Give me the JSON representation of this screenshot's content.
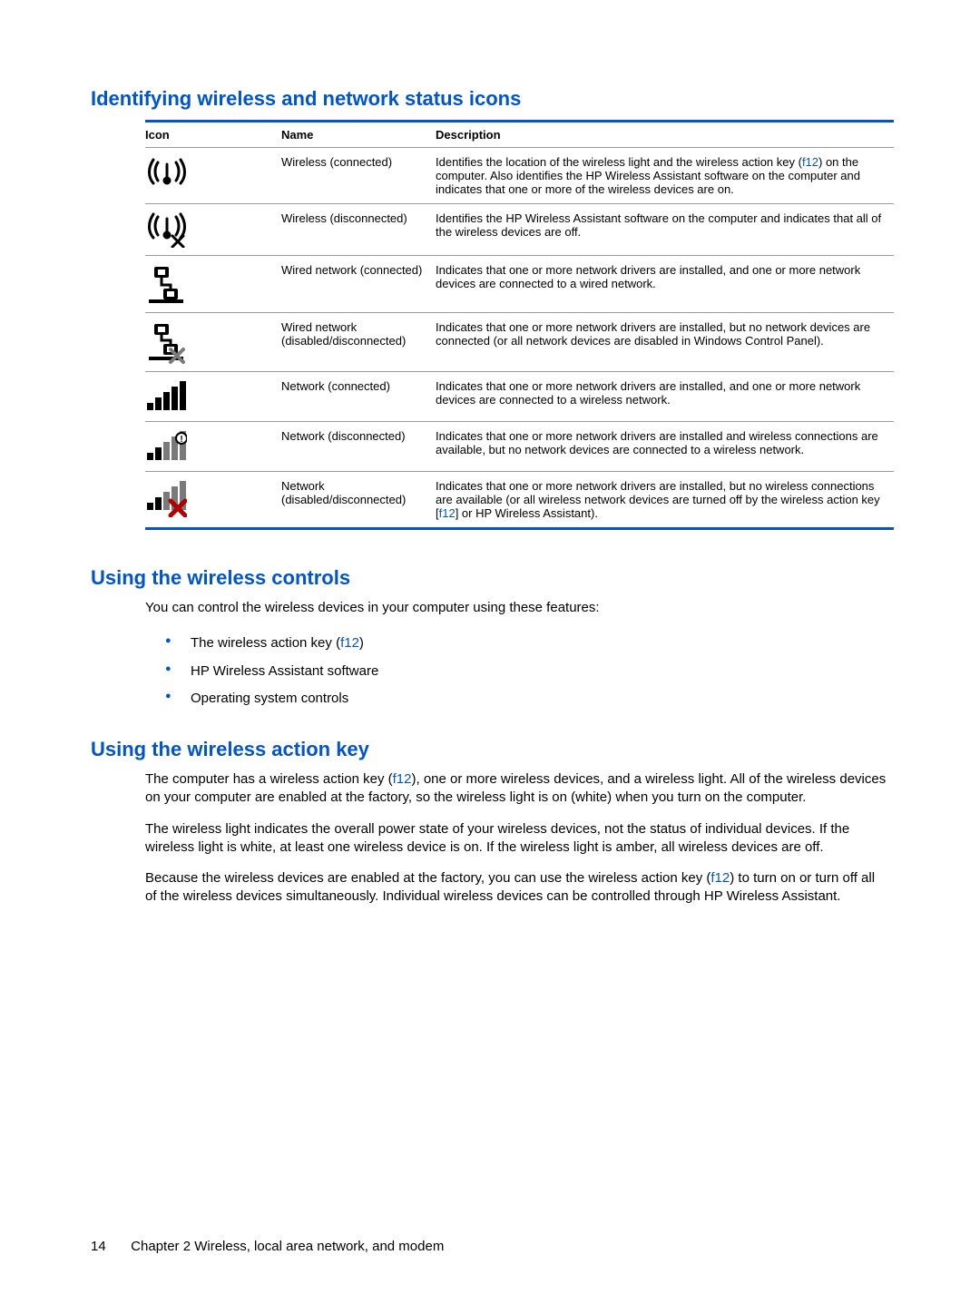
{
  "section1": {
    "title": "Identifying wireless and network status icons",
    "headers": {
      "icon": "Icon",
      "name": "Name",
      "desc": "Description"
    },
    "rows": [
      {
        "name": "Wireless (connected)",
        "desc_pre": "Identifies the location of the wireless light and the wireless action key (",
        "desc_key": "f12",
        "desc_post": ") on the computer. Also identifies the HP Wireless Assistant software on the computer and indicates that one or more of the wireless devices are on."
      },
      {
        "name": "Wireless (disconnected)",
        "desc": "Identifies the HP Wireless Assistant software on the computer and indicates that all of the wireless devices are off."
      },
      {
        "name": "Wired network (connected)",
        "desc": "Indicates that one or more network drivers are installed, and one or more network devices are connected to a wired network."
      },
      {
        "name": "Wired network (disabled/disconnected)",
        "desc": "Indicates that one or more network drivers are installed, but no network devices are connected (or all network devices are disabled in Windows Control Panel)."
      },
      {
        "name": "Network (connected)",
        "desc": "Indicates that one or more network drivers are installed, and one or more network devices are connected to a wireless network."
      },
      {
        "name": "Network (disconnected)",
        "desc": "Indicates that one or more network drivers are installed and wireless connections are available, but no network devices are connected to a wireless network."
      },
      {
        "name": "Network (disabled/disconnected)",
        "desc_pre": "Indicates that one or more network drivers are installed, but no wireless connections are available (or all wireless network devices are turned off by the wireless action key [",
        "desc_key": "f12",
        "desc_post": "] or HP Wireless Assistant)."
      }
    ]
  },
  "section2": {
    "title": "Using the wireless controls",
    "intro": "You can control the wireless devices in your computer using these features:",
    "bullets": {
      "b1_pre": "The wireless action key (",
      "b1_key": "f12",
      "b1_post": ")",
      "b2": "HP Wireless Assistant software",
      "b3": "Operating system controls"
    }
  },
  "section3": {
    "title": "Using the wireless action key",
    "p1_pre": "The computer has a wireless action key (",
    "p1_key": "f12",
    "p1_post": "), one or more wireless devices, and a wireless light. All of the wireless devices on your computer are enabled at the factory, so the wireless light is on (white) when you turn on the computer.",
    "p2": "The wireless light indicates the overall power state of your wireless devices, not the status of individual devices. If the wireless light is white, at least one wireless device is on. If the wireless light is amber, all wireless devices are off.",
    "p3_pre": "Because the wireless devices are enabled at the factory, you can use the wireless action key (",
    "p3_key": "f12",
    "p3_post": ") to turn on or turn off all of the wireless devices simultaneously. Individual wireless devices can be controlled through HP Wireless Assistant."
  },
  "footer": {
    "page": "14",
    "chapter": "Chapter 2   Wireless, local area network, and modem"
  }
}
